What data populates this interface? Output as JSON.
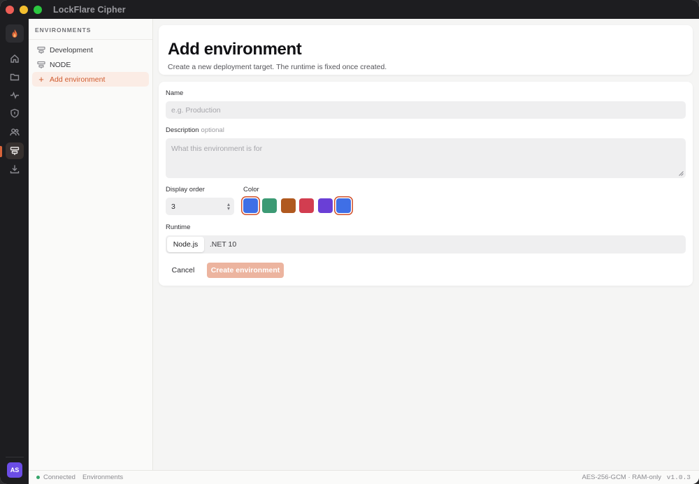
{
  "window": {
    "title": "LockFlare Cipher"
  },
  "rail": {
    "avatar_initials": "AS",
    "items": [
      {
        "icon": "home-icon"
      },
      {
        "icon": "folder-icon"
      },
      {
        "icon": "activity-icon"
      },
      {
        "icon": "shield-icon"
      },
      {
        "icon": "users-icon"
      },
      {
        "icon": "environments-icon",
        "active": true
      },
      {
        "icon": "download-icon"
      }
    ],
    "accent": "#d8643a"
  },
  "sidebar": {
    "heading": "ENVIRONMENTS",
    "items": [
      {
        "label": "Development",
        "icon": "environment-icon"
      },
      {
        "label": "NODE",
        "icon": "environment-icon"
      },
      {
        "label": "Add environment",
        "icon": "plus-icon",
        "active": true
      }
    ]
  },
  "header": {
    "title": "Add environment",
    "subtitle": "Create a new deployment target. The runtime is fixed once created."
  },
  "form": {
    "name_label": "Name",
    "name_placeholder": "e.g. Production",
    "name_value": "",
    "description_label": "Description",
    "description_optional": "optional",
    "description_placeholder": "What this environment is for",
    "description_value": "",
    "order_label": "Display order",
    "order_value": "3",
    "color_label": "Color",
    "colors": [
      "#3f6fe6",
      "#3c9a74",
      "#b0591f",
      "#d23d50",
      "#6a3fd6",
      "#3f6fe6"
    ],
    "selected_color_indices": [
      0,
      5
    ],
    "runtime_label": "Runtime",
    "runtime_options": [
      "Node.js",
      ".NET 10"
    ],
    "runtime_selected": "Node.js",
    "cancel_label": "Cancel",
    "create_label": "Create environment"
  },
  "statusbar": {
    "connection": "Connected",
    "view": "Environments",
    "cipher": "AES-256-GCM · RAM-only",
    "version": "v1.0.3"
  }
}
